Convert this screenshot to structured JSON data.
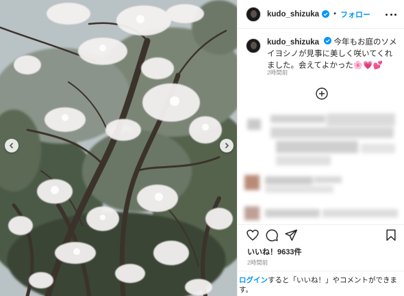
{
  "post": {
    "username": "kudo_shizuka",
    "follow_label": "フォロー",
    "separator": "•",
    "caption": "今年もお庭のソメイヨシノが見事に美しく咲いてくれました。会えてよかった🌸💗💕",
    "caption_time": "2時間前",
    "likes": "いいね！9633件",
    "post_time": "2時間前"
  },
  "login_prompt": {
    "link": "ログイン",
    "text": "すると「いいね！」やコメントができます。"
  },
  "icons": {
    "more": "more-options-icon",
    "verified": "verified-badge-icon",
    "add_comment": "add-circle-icon",
    "like": "heart-icon",
    "comment": "comment-icon",
    "share": "share-icon",
    "save": "bookmark-icon",
    "prev": "chevron-left-icon",
    "next": "chevron-right-icon"
  },
  "colors": {
    "accent": "#0095f6",
    "text": "#262626",
    "muted": "#8e8e8e",
    "border": "#efefef"
  }
}
